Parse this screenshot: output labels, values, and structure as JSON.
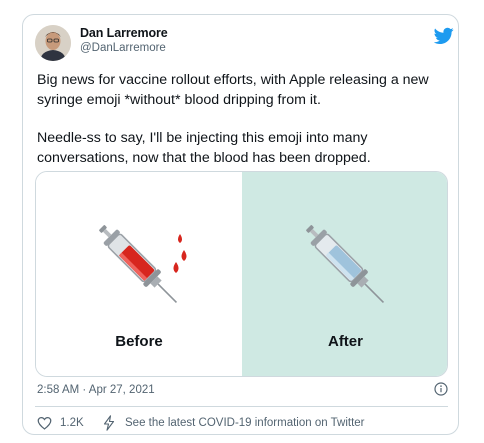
{
  "author": {
    "name": "Dan Larremore",
    "handle": "@DanLarremore"
  },
  "icons": {
    "brand": "twitter-bird-icon",
    "info": "info-icon",
    "like": "heart-icon",
    "covid": "lightning-icon"
  },
  "tweet": {
    "paragraph1": "Big news for vaccine rollout efforts, with Apple releasing a new syringe emoji *without* blood dripping from it.",
    "paragraph2": "Needle-ss to say, I'll be injecting this emoji into many conversations, now that the blood has been dropped."
  },
  "media": {
    "left_label": "Before",
    "right_label": "After",
    "right_bg": "#cfe9e3"
  },
  "timestamp": "2:58 AM · Apr 27, 2021",
  "actions": {
    "likes": "1.2K",
    "covid_link": "See the latest COVID-19 information on Twitter"
  },
  "colors": {
    "twitter_blue": "#1d9bf0",
    "secondary_text": "#536471",
    "border": "#cfd9de"
  }
}
